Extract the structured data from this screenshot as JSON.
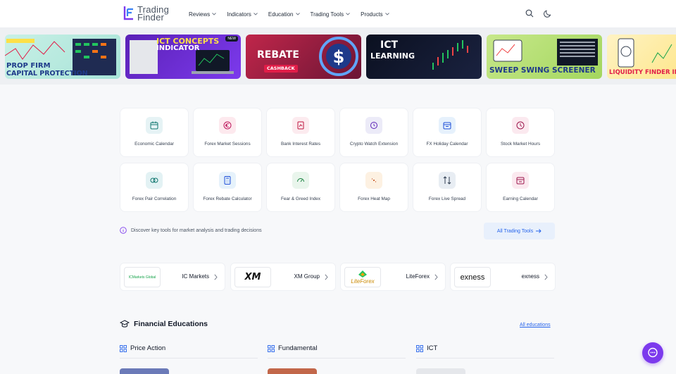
{
  "header": {
    "logo_line1": "Trading",
    "logo_line2": "Finder",
    "nav": [
      "Reviews",
      "Indicators",
      "Education",
      "Trading Tools",
      "Products"
    ]
  },
  "banners": [
    {
      "title1": "PROP FIRM",
      "title2": "CAPITAL PROTECTION"
    },
    {
      "title1": "ICT CONCEPTS",
      "title2": "INDICATOR",
      "badge": "NEW"
    },
    {
      "title1": "REBATE",
      "title2": "CASHBACK"
    },
    {
      "title1": "ICT",
      "title2": "LEARNING"
    },
    {
      "title1": "SWEEP SWING SCREENER"
    },
    {
      "title1": "LIQUIDITY FINDER IND"
    }
  ],
  "tools": [
    {
      "label": "Economic Calendar",
      "icon": "calendar-icon",
      "color": "#e6f3f5"
    },
    {
      "label": "Forex Market Sessions",
      "icon": "currency-icon",
      "color": "#fde9ee"
    },
    {
      "label": "Bank Interest Rates",
      "icon": "chart-doc-icon",
      "color": "#fcebef"
    },
    {
      "label": "Crypto Watch Extension",
      "icon": "watch-icon",
      "color": "#ecebf8"
    },
    {
      "label": "FX Holiday Calendar",
      "icon": "holiday-calendar-icon",
      "color": "#e6f1fc"
    },
    {
      "label": "Stock Market Hours",
      "icon": "clock-icon",
      "color": "#fbe9ef"
    },
    {
      "label": "Forex Pair Correlation",
      "icon": "correlation-icon",
      "color": "#e3f2f4"
    },
    {
      "label": "Forex Rebate Calculator",
      "icon": "calculator-icon",
      "color": "#e6f2fb"
    },
    {
      "label": "Fear & Greed Index",
      "icon": "gauge-icon",
      "color": "#e9f5ec"
    },
    {
      "label": "Forex Heat Map",
      "icon": "heatmap-icon",
      "color": "#fdf1e2"
    },
    {
      "label": "Forex Live Spread",
      "icon": "spread-icon",
      "color": "#e8edf3"
    },
    {
      "label": "Earning Calendar",
      "icon": "earning-calendar-icon",
      "color": "#fbe9ef"
    }
  ],
  "discover_text": "Discover key tools for market analysis and trading decisions",
  "all_tools_label": "All Trading Tools",
  "brokers": [
    {
      "name": "IC Markets",
      "logo_text": "ICMarkets Global"
    },
    {
      "name": "XM Group",
      "logo_text": "XM"
    },
    {
      "name": "LiteForex",
      "logo_text": "LiteForex"
    },
    {
      "name": "exness",
      "logo_text": "exness"
    }
  ],
  "educations": {
    "title": "Financial Educations",
    "all_label": "All educations",
    "tabs": [
      "Price Action",
      "Fundamental",
      "ICT"
    ]
  },
  "colors": {
    "accent": "#2563eb",
    "chat": "#7c3aed"
  }
}
